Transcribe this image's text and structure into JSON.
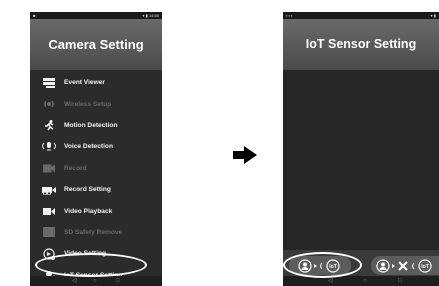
{
  "screen1": {
    "status_left": "■",
    "status_right": "▾ ▮ 14:58",
    "title": "Camera Setting",
    "menu": [
      {
        "label": "Event Viewer",
        "icon": "event-viewer-icon",
        "enabled": true
      },
      {
        "label": "Wireless Setup",
        "icon": "wireless-icon",
        "enabled": false
      },
      {
        "label": "Motion Detection",
        "icon": "running-person-icon",
        "enabled": true
      },
      {
        "label": "Voice Detection",
        "icon": "voice-icon",
        "enabled": true
      },
      {
        "label": "Record",
        "icon": "record-camera-icon",
        "enabled": false
      },
      {
        "label": "Record Setting",
        "icon": "record-setting-icon",
        "enabled": true
      },
      {
        "label": "Video Playback",
        "icon": "video-playback-icon",
        "enabled": true
      },
      {
        "label": "SD Safety Remove",
        "icon": "sd-card-icon",
        "enabled": false
      },
      {
        "label": "Video Setting",
        "icon": "video-setting-icon",
        "enabled": true
      },
      {
        "label": "IoT Sensor Setting",
        "icon": "iot-sensor-icon",
        "enabled": true
      }
    ],
    "nav": [
      "◁",
      "○",
      "□"
    ]
  },
  "screen2": {
    "status_left": "▪ ▪ ▪",
    "status_right": "▾ ▮",
    "title": "IoT Sensor Setting",
    "buttons": [
      {
        "name": "iot-sensor-connected",
        "icon": "sensor-to-iot-icon"
      },
      {
        "name": "iot-sensor-disconnected",
        "icon": "sensor-x-iot-icon"
      }
    ],
    "nav": [
      "◁",
      "○",
      "□"
    ]
  },
  "colors": {
    "panel": "#2b2b2b",
    "header": "#5a5a5a",
    "text": "#f2f2f2",
    "disabled_text": "#6a6a6a",
    "highlight": "#ffffff"
  }
}
